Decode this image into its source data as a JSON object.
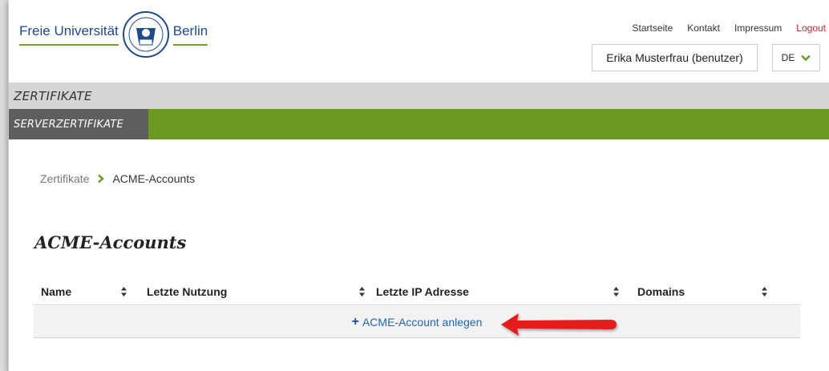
{
  "header": {
    "logo_left": "Freie Universität",
    "logo_right": "Berlin",
    "nav": [
      "Startseite",
      "Kontakt",
      "Impressum"
    ],
    "logout": "Logout",
    "user": "Erika Musterfrau (benutzer)",
    "language": "DE"
  },
  "section_bar": {
    "label": "ZERTIFIKATE"
  },
  "subnav": {
    "active_tab": "SERVERZERTIFIKATE"
  },
  "breadcrumb": {
    "parent": "Zertifikate",
    "current": "ACME-Accounts"
  },
  "page_title": "ACME-Accounts",
  "table": {
    "columns": [
      "Name",
      "Letzte Nutzung",
      "Letzte IP Adresse",
      "Domains"
    ],
    "add_action": "ACME-Account anlegen"
  },
  "colors": {
    "accent_green": "#6a9a23",
    "brand_blue": "#1e4a8c",
    "logout_red": "#c0272d",
    "annotation_arrow": "#e41e1e"
  }
}
